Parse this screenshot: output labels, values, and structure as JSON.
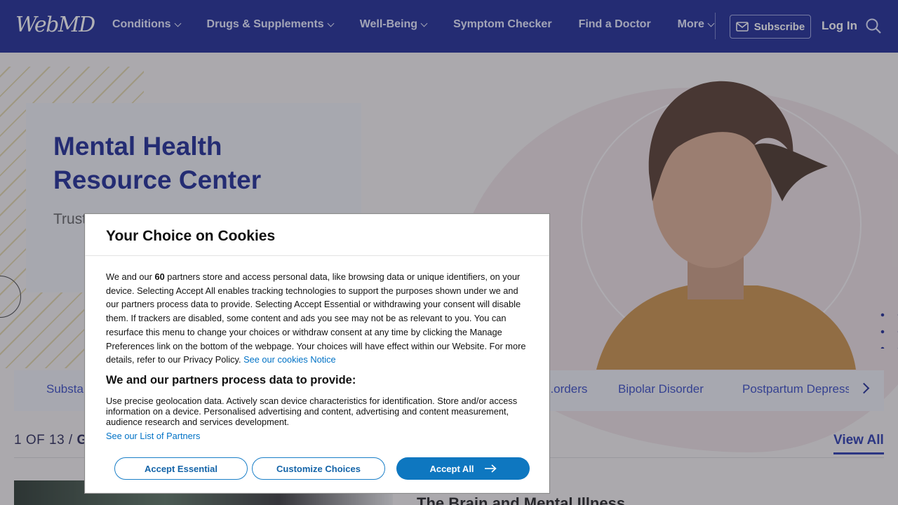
{
  "header": {
    "logo": "WebMD",
    "nav": [
      {
        "label": "Conditions",
        "dropdown": true
      },
      {
        "label": "Drugs & Supplements",
        "dropdown": true
      },
      {
        "label": "Well-Being",
        "dropdown": true
      },
      {
        "label": "Symptom Checker",
        "dropdown": false
      },
      {
        "label": "Find a Doctor",
        "dropdown": false
      },
      {
        "label": "More",
        "dropdown": true
      }
    ],
    "subscribe_label": "Subscribe",
    "login_label": "Log In"
  },
  "hero": {
    "title_line1": "Mental Health",
    "title_line2": "Resource Center",
    "subtitle": "Trust... resou..."
  },
  "topics": [
    "Substan...",
    "...orders",
    "Bipolar Disorder",
    "Postpartum Depress..."
  ],
  "section": {
    "counter_prefix": "1 OF 13 / ",
    "counter_bold": "G",
    "view_all": "View All",
    "article_title": "The Brain and Mental Illness"
  },
  "cookie_dialog": {
    "title": "Your Choice on Cookies",
    "body_part1": "We and our ",
    "partner_count": "60",
    "body_part2": " partners store and access personal data, like browsing data or unique identifiers, on your device. Selecting Accept All enables tracking technologies to support the purposes shown under we and our partners process data to provide. Selecting Accept Essential or withdrawing your consent will disable them. If trackers are disabled, some content and ads you see may not be as relevant to you. You can resurface this menu to change your choices or withdraw consent at any time by clicking the Manage Preferences link on the bottom of the webpage. Your choices will have effect within our Website. For more details, refer to our Privacy Policy.",
    "cookies_notice_link": "See our cookies Notice",
    "purposes_heading": "We and our partners process data to provide:",
    "purposes_text": "Use precise geolocation data. Actively scan device characteristics for identification. Store and/or access information on a device. Personalised advertising and content, advertising and content measurement, audience research and services development.",
    "partners_link": "See our List of Partners",
    "accept_essential": "Accept Essential",
    "customize": "Customize Choices",
    "accept_all": "Accept All"
  },
  "colors": {
    "header_bg": "#0d1b8c",
    "brand_blue": "#0d1b8c",
    "link_blue": "#0072c6",
    "button_blue": "#0e77c0"
  }
}
